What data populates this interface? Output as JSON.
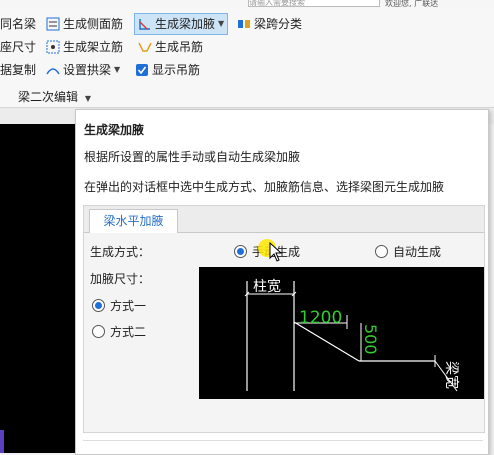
{
  "top": {
    "search_placeholder": "请输入需要搜索",
    "right_text": "欢迎您, 广联达"
  },
  "ribbon": {
    "row1": [
      {
        "label": "同名梁",
        "icon": "copy-icon"
      },
      {
        "label": "生成侧面筋",
        "icon": "side-rebar-icon"
      },
      {
        "label": "生成梁加腋",
        "icon": "beam-haunch-icon",
        "dropdown": true,
        "active": true
      },
      {
        "label": "梁跨分类",
        "icon": "span-classify-icon"
      }
    ],
    "row2": [
      {
        "label": "座尺寸"
      },
      {
        "label": "生成架立筋",
        "icon": "erection-rebar-icon"
      },
      {
        "label": "生成吊筋",
        "icon": "hanger-rebar-icon"
      }
    ],
    "row3": [
      {
        "label": "据复制"
      },
      {
        "label": "设置拱梁",
        "icon": "arch-beam-icon",
        "dropdown": true
      },
      {
        "label": "显示吊筋",
        "icon": "checkbox-icon",
        "checked": true
      }
    ],
    "group_label": "梁二次编辑"
  },
  "tooltip": {
    "title": "生成梁加腋",
    "line1": "根据所设置的属性手动或自动生成梁加腋",
    "line2": "在弹出的对话框中选中生成方式、加腋筋信息、选择梁图元生成加腋",
    "dialog": {
      "tab": "梁水平加腋",
      "mode_label": "生成方式：",
      "mode_options": [
        "手动生成",
        "自动生成"
      ],
      "mode_selected": "手动生成",
      "size_label": "加腋尺寸：",
      "size_options": [
        "方式一",
        "方式二"
      ],
      "size_selected": "方式一",
      "preview": {
        "column_width": "柱宽",
        "length": "1200",
        "height": "500",
        "beam_width": "梁宽"
      }
    }
  },
  "colors": {
    "accent": "#2a6fc9",
    "active_bg": "#cde4f7",
    "preview_num": "#33cc33"
  }
}
